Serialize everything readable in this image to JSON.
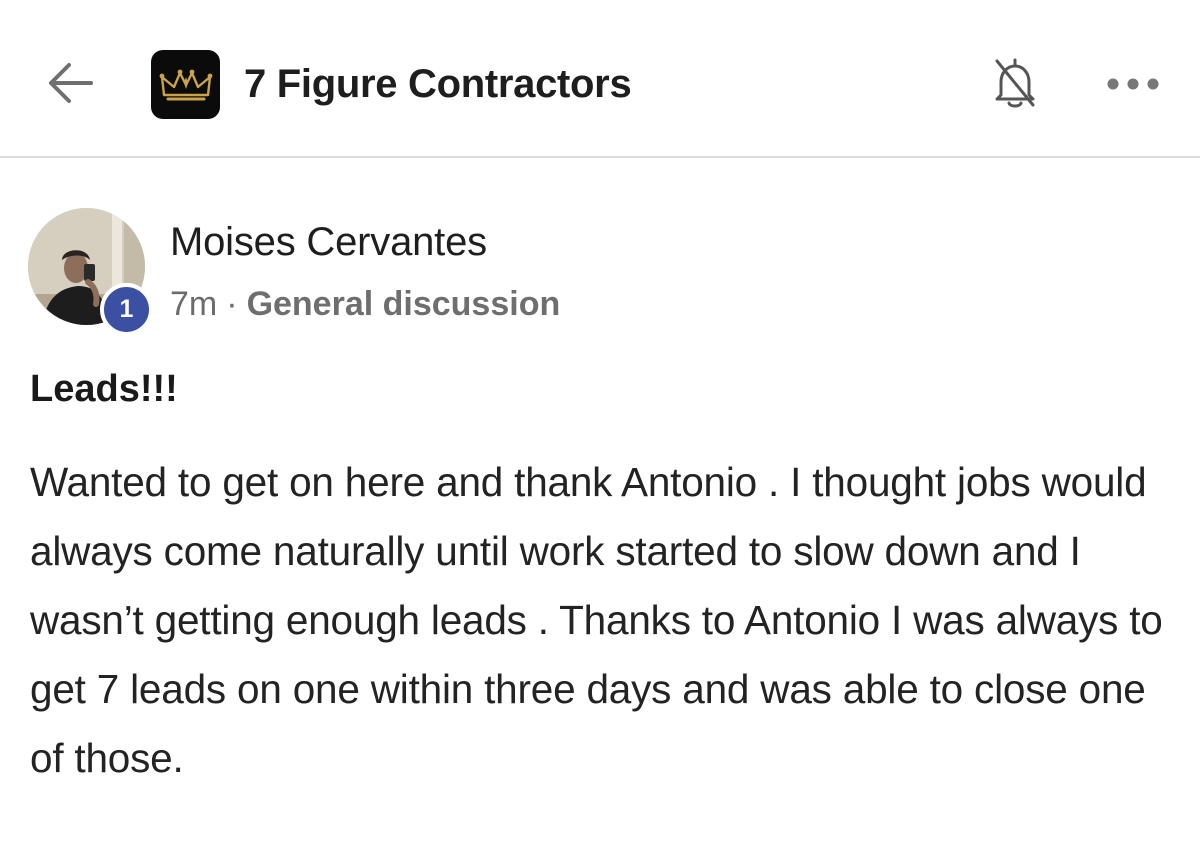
{
  "header": {
    "group_name": "7 Figure Contractors",
    "icons": [
      "arrow-left-icon",
      "crown-logo",
      "bell-off-icon",
      "more-horizontal-icon"
    ]
  },
  "post": {
    "author": "Moises Cervantes",
    "level": "1",
    "time": "7m",
    "separator": "·",
    "category": "General discussion",
    "title": "Leads!!!",
    "body": "Wanted to get on here and thank Antonio . I thought jobs would always come naturally until work started to slow down and I wasn’t getting enough leads . Thanks to Antonio I was always to get 7 leads on one within three days and was able to close one of those."
  },
  "colors": {
    "badge": "#3b4fa3",
    "logo_bg": "#0b0b0b",
    "logo_crown": "#c9a24a",
    "meta_text": "#6e6e6e",
    "divider": "#dcdcdc"
  }
}
